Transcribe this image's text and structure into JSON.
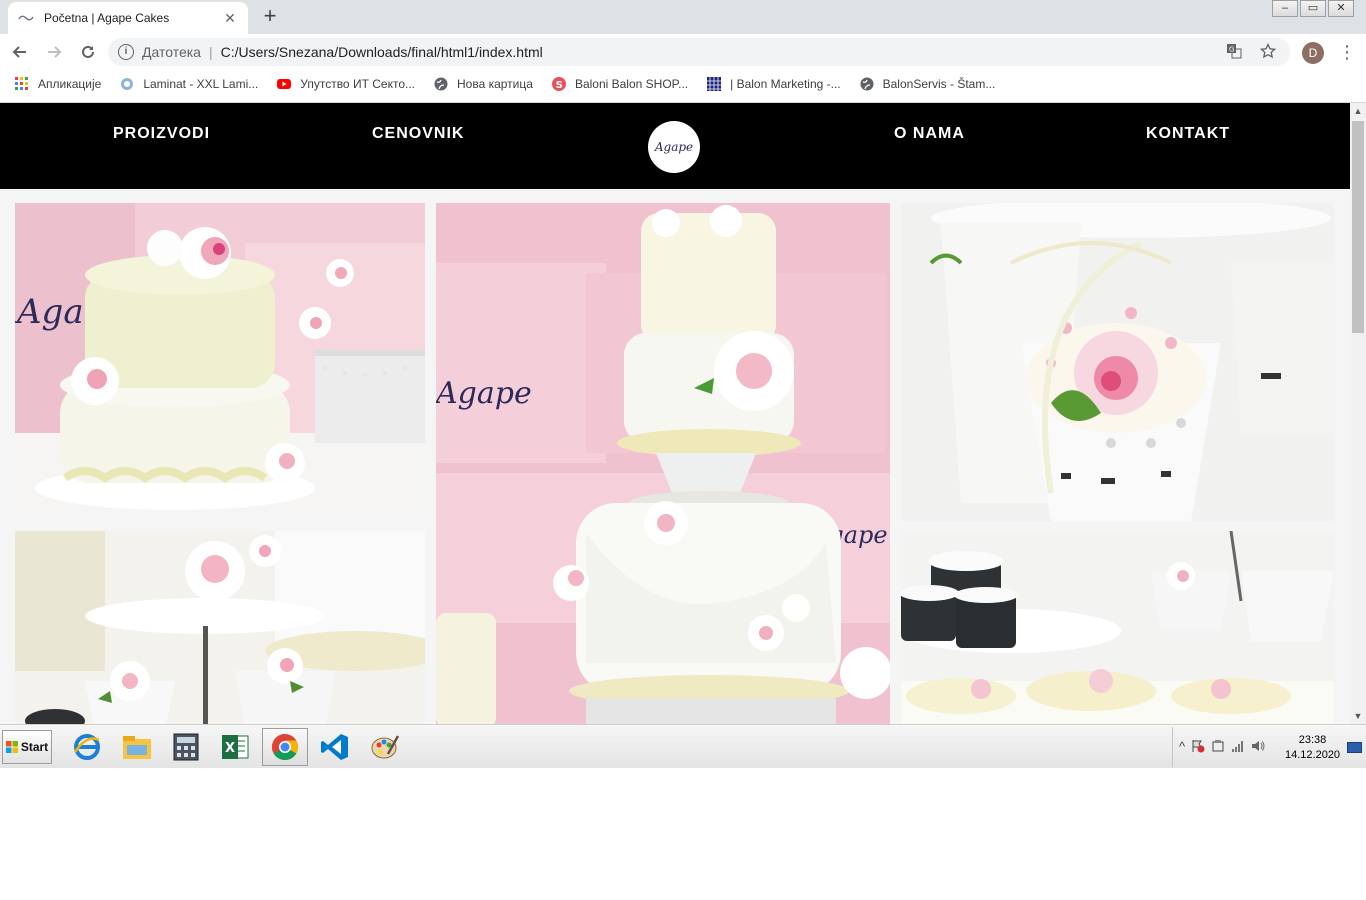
{
  "browser": {
    "tab": {
      "title": "Početna | Agape Cakes",
      "close_glyph": "✕"
    },
    "new_tab_glyph": "+",
    "window_controls": [
      "–",
      "▭",
      "✕"
    ],
    "address": {
      "security_label": "Датотека",
      "url": "C:/Users/Snezana/Downloads/final/html1/index.html"
    },
    "profile_initial": "D",
    "bookmarks": [
      {
        "label": "Апликације",
        "icon": "apps-grid-icon"
      },
      {
        "label": "Laminat - XXL Lami...",
        "icon": "site-favicon-icon"
      },
      {
        "label": "Упутство ИТ Секто...",
        "icon": "youtube-icon"
      },
      {
        "label": "Нова картица",
        "icon": "globe-icon"
      },
      {
        "label": "Baloni Balon SHOP...",
        "icon": "s-logo-icon"
      },
      {
        "label": "| Balon Marketing -...",
        "icon": "grid-favicon-icon"
      },
      {
        "label": "BalonServis - Štam...",
        "icon": "globe-icon"
      }
    ]
  },
  "site": {
    "nav": {
      "links": [
        "PROIZVODI",
        "CENOVNIK",
        "O NAMA",
        "KONTAKT"
      ],
      "logo_text": "Agape"
    },
    "gallery": [
      {
        "alt": "two-tier cake with roses"
      },
      {
        "alt": "tall wedding cake"
      },
      {
        "alt": "lace cupcake with rose"
      },
      {
        "alt": "cupcakes on stand"
      },
      {
        "alt": "cupcakes and teacups"
      }
    ]
  },
  "taskbar": {
    "start_label": "Start",
    "apps": [
      "internet-explorer-icon",
      "file-explorer-icon",
      "calculator-icon",
      "excel-icon",
      "chrome-icon",
      "vscode-icon",
      "paint-icon"
    ],
    "clock_time": "23:38",
    "clock_date": "14.12.2020"
  },
  "colors": {
    "nav_bg": "#000000",
    "accent_pink": "#f4c6d4",
    "cream": "#f5f1d8"
  }
}
